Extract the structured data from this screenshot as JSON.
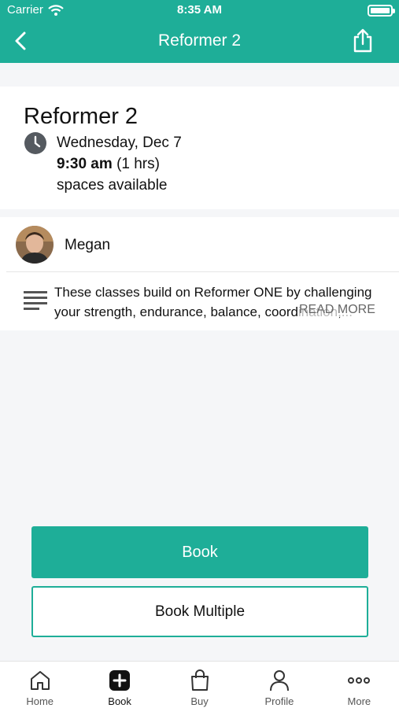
{
  "status_bar": {
    "carrier": "Carrier",
    "time": "8:35 AM"
  },
  "nav": {
    "title": "Reformer 2"
  },
  "class_info": {
    "title": "Reformer 2",
    "date": "Wednesday, Dec 7",
    "time": "9:30 am",
    "duration": "(1 hrs)",
    "spaces": "spaces available"
  },
  "instructor": {
    "name": "Megan"
  },
  "description": {
    "text": "These classes build on Reformer ONE by challenging your strength, endurance, balance, coordination,...",
    "read_more": "READ MORE"
  },
  "actions": {
    "book": "Book",
    "book_multiple": "Book Multiple"
  },
  "tabs": [
    {
      "label": "Home",
      "icon": "home-icon"
    },
    {
      "label": "Book",
      "icon": "plus-square-icon"
    },
    {
      "label": "Buy",
      "icon": "shopping-bag-icon"
    },
    {
      "label": "Profile",
      "icon": "person-icon"
    },
    {
      "label": "More",
      "icon": "ellipsis-icon"
    }
  ],
  "colors": {
    "accent": "#1eae98",
    "background": "#f5f6f8"
  }
}
